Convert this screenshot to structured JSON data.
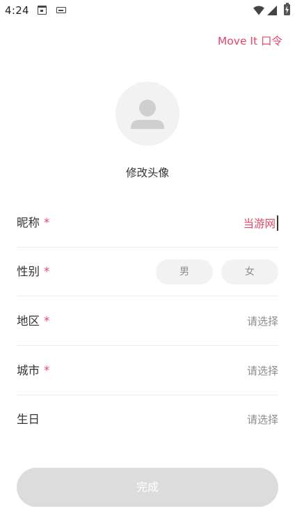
{
  "status_bar": {
    "time": "4:24",
    "icons": [
      "calendar-icon",
      "keyboard-icon",
      "wifi-icon",
      "signal-icon",
      "battery-charging-icon"
    ]
  },
  "header": {
    "action_label": "Move It 口令"
  },
  "avatar": {
    "change_label": "修改头像",
    "icon": "person-placeholder-icon"
  },
  "form": {
    "required_mark": "*",
    "nickname": {
      "label": "昵称",
      "value": "当游网"
    },
    "gender": {
      "label": "性别",
      "options": [
        "男",
        "女"
      ]
    },
    "region": {
      "label": "地区",
      "value": "请选择"
    },
    "city": {
      "label": "城市",
      "value": "请选择"
    },
    "birthday": {
      "label": "生日",
      "value": "请选择"
    }
  },
  "submit": {
    "label": "完成"
  },
  "colors": {
    "accent": "#e1466a",
    "button_disabled": "#dcdcdc",
    "placeholder_gray": "#8c8c8c"
  }
}
